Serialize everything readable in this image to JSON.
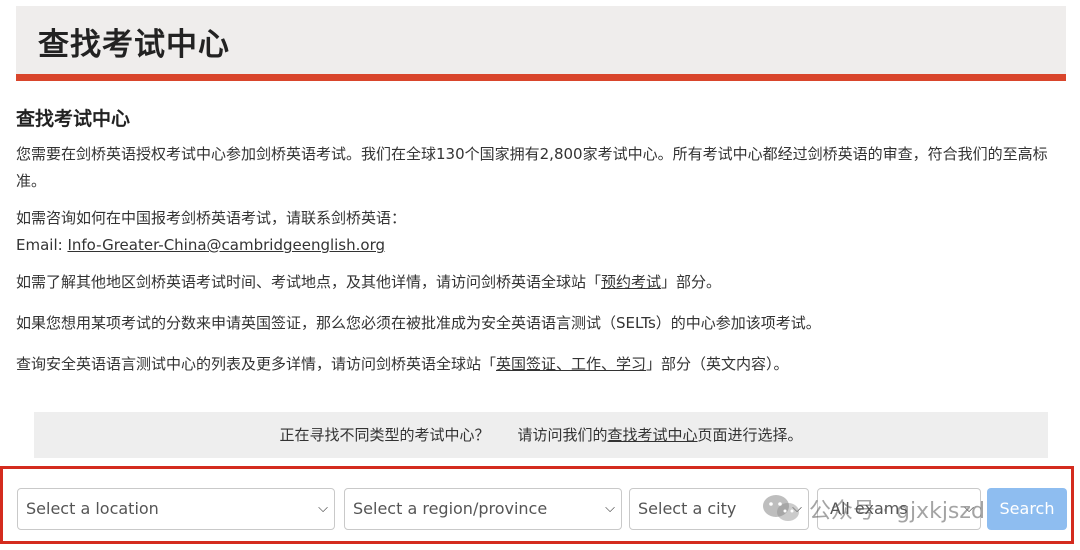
{
  "header": {
    "title": "查找考试中心"
  },
  "content": {
    "heading": "查找考试中心",
    "p1": "您需要在剑桥英语授权考试中心参加剑桥英语考试。我们在全球130个国家拥有2,800家考试中心。所有考试中心都经过剑桥英语的审查，符合我们的至高标准。",
    "p2_line1": "如需咨询如何在中国报考剑桥英语考试，请联系剑桥英语：",
    "p2_email_label": "Email: ",
    "p2_email": "Info-Greater-China@cambridgeenglish.org",
    "p3_pre": "如需了解其他地区剑桥英语考试时间、考试地点，及其他详情，请访问剑桥英语全球站「",
    "p3_link": "预约考试",
    "p3_post": "」部分。",
    "p4": "如果您想用某项考试的分数来申请英国签证，那么您必须在被批准成为安全英语语言测试（SELTs）的中心参加该项考试。",
    "p5_pre": "查询安全英语语言测试中心的列表及更多详情，请访问剑桥英语全球站「",
    "p5_link": "英国签证、工作、学习",
    "p5_post": "」部分（英文内容）。"
  },
  "notice": {
    "part1": "正在寻找不同类型的考试中心？",
    "part2_pre": "请访问我们的",
    "part2_link": "查找考试中心",
    "part2_post": "页面进行选择。"
  },
  "search": {
    "location": "Select a location",
    "region": "Select a region/province",
    "city": "Select a city",
    "exams": "All exams",
    "button": "Search"
  },
  "watermark": {
    "text": "公众号 · gjxkjszd"
  },
  "colors": {
    "accent": "#d9452b",
    "highlight_border": "#d42b1e",
    "button": "#8ebdf0"
  }
}
